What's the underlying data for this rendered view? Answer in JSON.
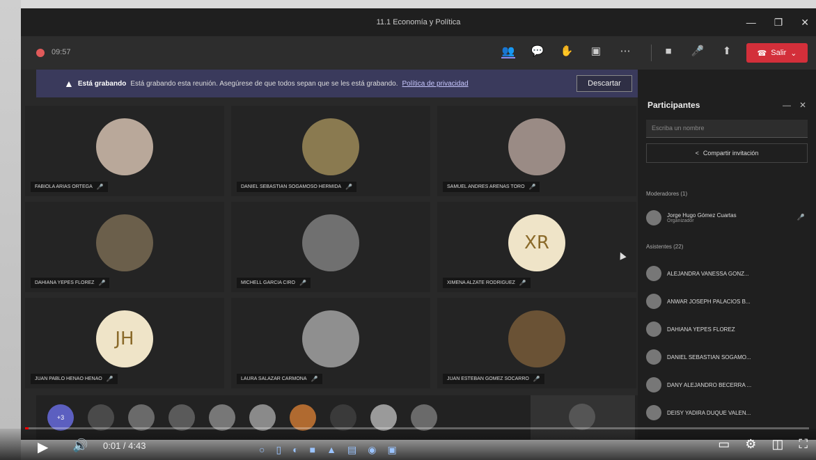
{
  "window": {
    "title": "11.1 Economía y Política",
    "minimize_icon": "—",
    "maximize_icon": "❐",
    "close_icon": "✕"
  },
  "toolbar": {
    "timer": "09:57",
    "leave_label": "Salir"
  },
  "banner": {
    "bold": "Está grabando",
    "text": "Está grabando esta reunión. Asegúrese de que todos sepan que se les está grabando.",
    "link": "Política de privacidad",
    "dismiss": "Descartar"
  },
  "tiles": [
    {
      "name": "FABIOLA ARIAS ORTEGA",
      "initials": "",
      "color": "#b9a89a"
    },
    {
      "name": "DANIEL SEBASTIAN SOGAMOSO HERMIDA",
      "initials": "",
      "color": "#8a7a50"
    },
    {
      "name": "SAMUEL ANDRES ARENAS TORO",
      "initials": "",
      "color": "#9a8b85"
    },
    {
      "name": "DAHIANA YEPES FLOREZ",
      "initials": "",
      "color": "#6b5f4b"
    },
    {
      "name": "MICHELL GARCIA CIRO",
      "initials": "",
      "color": "#707070"
    },
    {
      "name": "XIMENA ALZATE RODRIGUEZ",
      "initials": "XR",
      "color": "#efe4c8"
    },
    {
      "name": "JUAN PABLO HENAO HENAO",
      "initials": "JH",
      "color": "#efe4c8"
    },
    {
      "name": "LAURA SALAZAR CARMONA",
      "initials": "",
      "color": "#8f8f8f"
    },
    {
      "name": "JUAN ESTEBAN GOMEZ SOCARRO",
      "initials": "",
      "color": "#6a5235"
    }
  ],
  "strip": {
    "plus_label": "+3",
    "thumb_colors": [
      "#4a4a4a",
      "#6a6a6a",
      "#5a5a5a",
      "#777777",
      "#8a8a8a",
      "#b06a30",
      "#3a3a3a",
      "#9a9a9a",
      "#6a6a6a"
    ]
  },
  "panel": {
    "title": "Participantes",
    "minimize_icon": "—",
    "close_icon": "✕",
    "search_placeholder": "Escriba un nombre",
    "share_label": "Compartir invitación",
    "moderators_header": "Moderadores (1)",
    "attendees_header": "Asistentes (22)",
    "organizer": {
      "name": "Jorge Hugo Gómez Cuartas",
      "role": "Organizador"
    },
    "attendees": [
      "ALEJANDRA VANESSA GONZ...",
      "ANWAR JOSEPH PALACIOS B...",
      "DAHIANA YEPES FLOREZ",
      "DANIEL SEBASTIAN SOGAMO...",
      "DANY ALEJANDRO BECERRA ...",
      "DEISY YADIRA DUQUE VALEN..."
    ]
  },
  "player": {
    "time": "0:01 / 4:43",
    "progress": 0.004
  }
}
